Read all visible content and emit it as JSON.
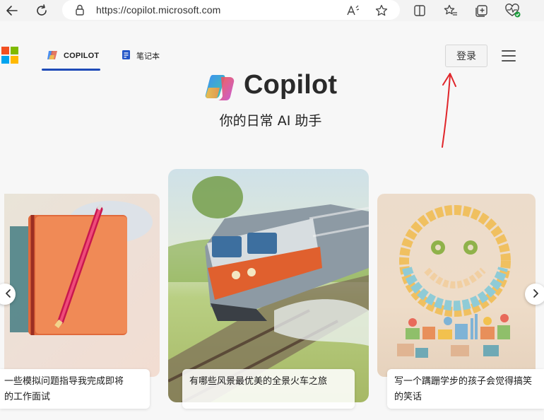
{
  "browser": {
    "url": "https://copilot.microsoft.com",
    "icons": [
      "back-icon",
      "refresh-icon",
      "lock-icon",
      "read-aloud-icon",
      "favorite-icon",
      "split-screen-icon",
      "favorites-list-icon",
      "collections-icon",
      "browser-essentials-icon"
    ]
  },
  "header": {
    "tabs": [
      {
        "label": "COPILOT",
        "icon": "copilot-icon",
        "active": true
      },
      {
        "label": "笔记本",
        "icon": "notebook-icon",
        "active": false
      }
    ],
    "login_label": "登录",
    "colors": {
      "accent": "#1f4bb8",
      "ms_red": "#f25022",
      "ms_green": "#7fba00",
      "ms_blue": "#00a4ef",
      "ms_yellow": "#ffb900"
    }
  },
  "hero": {
    "title": "Copilot",
    "subtitle": "你的日常 AI 助手"
  },
  "cards": [
    {
      "caption_line1": "一些模拟问题指导我完成即将",
      "caption_line2": "的工作面试",
      "image": "notebook-with-pencil"
    },
    {
      "caption_line1": "有哪些风景最优美的全景火车之旅",
      "caption_line2": "",
      "image": "train-in-countryside"
    },
    {
      "caption_line1": "写一个蹒跚学步的孩子会觉得搞笑",
      "caption_line2": "的笑话",
      "image": "smiley-face-blocks"
    }
  ],
  "carousel": {
    "prev_icon": "chevron-left-icon",
    "next_icon": "chevron-right-icon"
  }
}
